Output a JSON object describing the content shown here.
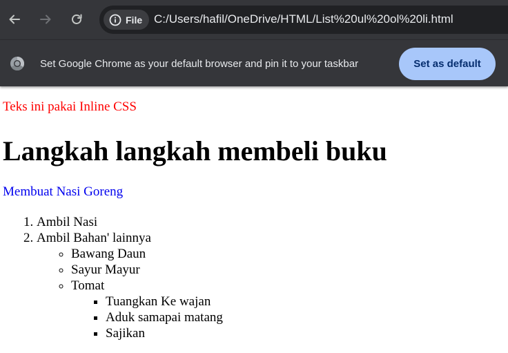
{
  "browser": {
    "chip_label": "File",
    "url": "C:/Users/hafil/OneDrive/HTML/List%20ul%20ol%20li.html",
    "infobar": {
      "message": "Set Google Chrome as your default browser and pin it to your taskbar",
      "button_label": "Set as default"
    },
    "colors": {
      "toolbar": "#35363a",
      "omnibox": "#202124",
      "button_bg": "#a8c7fa",
      "button_text": "#062e6f"
    }
  },
  "page": {
    "inline_text": "Teks ini pakai Inline CSS",
    "heading": "Langkah langkah membeli buku",
    "link_text": "Membuat Nasi Goreng",
    "steps": [
      "Ambil Nasi",
      "Ambil Bahan' lainnya"
    ],
    "ingredients": [
      "Bawang Daun",
      "Sayur Mayur",
      "Tomat"
    ],
    "instructions": [
      "Tuangkan Ke wajan",
      "Aduk samapai matang",
      "Sajikan"
    ],
    "colors": {
      "inline_text": "#ff0000",
      "link": "#0000ee"
    }
  }
}
